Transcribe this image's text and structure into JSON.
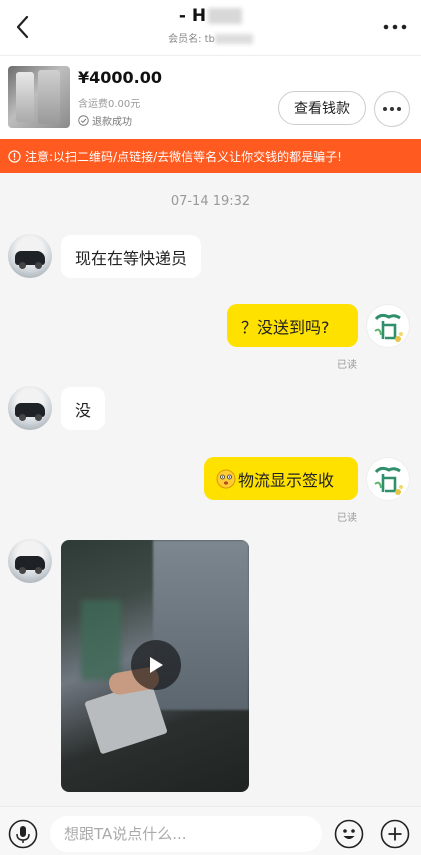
{
  "header": {
    "title": "- H",
    "member_label": "会员名: tb"
  },
  "product": {
    "price": "¥4000.00",
    "shipping": "含运费0.00元",
    "refund_status": "退款成功",
    "wallet_button": "查看钱款"
  },
  "warning": {
    "text": "注意:以扫二维码/点链接/去微信等名义让你交钱的都是骗子!"
  },
  "chat": {
    "timestamp": "07-14 19:32",
    "messages": [
      {
        "side": "left",
        "text": "现在在等快递员"
      },
      {
        "side": "right",
        "text": "？没送到吗?",
        "status": "已读"
      },
      {
        "side": "left",
        "text": "没"
      },
      {
        "side": "right",
        "text": "物流显示签收",
        "status": "已读"
      },
      {
        "side": "left",
        "type": "video"
      }
    ]
  },
  "input": {
    "placeholder": "想跟TA说点什么..."
  },
  "colors": {
    "accent_yellow": "#ffe100",
    "warning_orange": "#ff5a1f"
  },
  "icons": [
    "back-icon",
    "more-icon",
    "check-icon",
    "warning-icon",
    "play-icon",
    "microphone-icon",
    "emoji-icon",
    "plus-icon"
  ]
}
